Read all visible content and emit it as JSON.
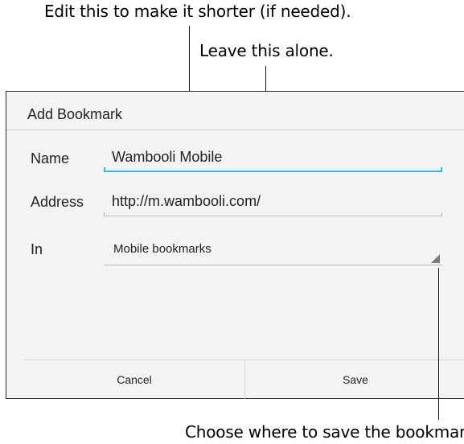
{
  "annotations": {
    "top_1": "Edit this to make it shorter (if needed).",
    "top_2": "Leave this alone.",
    "bottom": "Choose where to save the bookmark"
  },
  "dialog": {
    "title": "Add Bookmark",
    "fields": {
      "name": {
        "label": "Name",
        "value": "Wambooli Mobile"
      },
      "address": {
        "label": "Address",
        "value": "http://m.wambooli.com/"
      },
      "in": {
        "label": "In",
        "value": "Mobile bookmarks"
      }
    },
    "buttons": {
      "cancel": "Cancel",
      "save": "Save"
    }
  },
  "colors": {
    "focus_underline": "#33b5e5",
    "dialog_background": "#f3f3f3",
    "dialog_border": "#2b2b2b"
  }
}
